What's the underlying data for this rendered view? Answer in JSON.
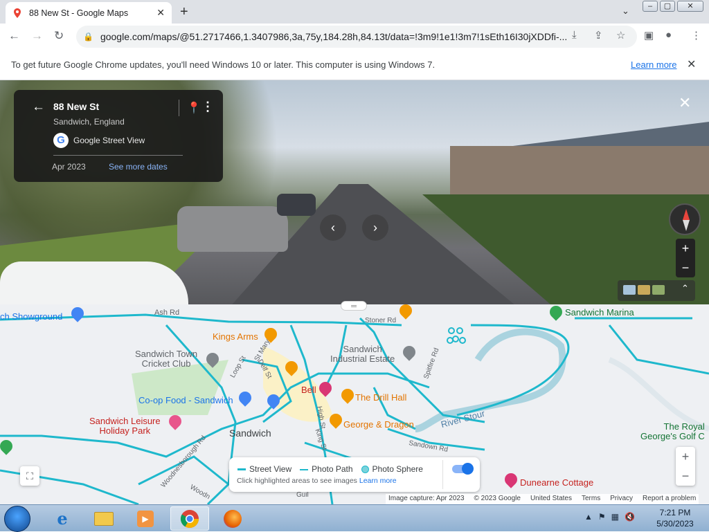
{
  "browser": {
    "tab_title": "88 New St - Google Maps",
    "tab_close": "✕",
    "new_tab": "+",
    "tab_menu": "⌄",
    "url": "google.com/maps/@51.2717466,1.3407986,3a,75y,184.28h,84.13t/data=!3m9!1e1!3m7!1sEth16I30jXDDfi-...",
    "window_controls": [
      "–",
      "▢",
      "✕"
    ]
  },
  "infobar": {
    "message": "To get future Google Chrome updates, you'll need Windows 10 or later. This computer is using Windows 7.",
    "link": "Learn more",
    "close": "✕"
  },
  "street_view": {
    "address": "88 New St",
    "location": "Sandwich, England",
    "provider": "Google Street View",
    "provider_logo": "G",
    "date": "Apr 2023",
    "see_more_dates": "See more dates",
    "close": "✕",
    "zoom_in": "+",
    "zoom_out": "−",
    "nav_prev": "‹",
    "nav_next": "›",
    "thumbs_toggle": "⌃"
  },
  "map": {
    "labels": {
      "showground": "ch Showground",
      "ash_rd": "Ash Rd",
      "kings_arms": "Kings Arms",
      "sandwich_town_cricket": "Sandwich Town\nCricket Club",
      "co_op": "Co-op Food - Sandwich",
      "sandwich_leisure": "Sandwich Leisure\nHoliday Park",
      "sandwich": "Sandwich",
      "industrial": "Sandwich\nIndustrial Estate",
      "stoner_rd": "Stoner Rd",
      "spitfire": "Spitfire Rd",
      "bell": "Bell",
      "drill_hall": "The Drill Hall",
      "george_dragon": "George & Dragon",
      "river_stour": "River Stour",
      "sandwich_marina": "Sandwich Marina",
      "royal_golf": "The Royal\nGeorge's Golf C",
      "dunearne": "Dunearne Cottage",
      "woodnesborough": "Woodnesborough Rd",
      "high_st": "High St",
      "king_st": "King St",
      "sandown_rd": "Sandown Rd",
      "loop_st": "Loop St",
      "delf_st": "Delf St",
      "st_marys": "St Mary's",
      "guil": "Guil",
      "woodn": "Woodn"
    },
    "legend": {
      "street_view": "Street View",
      "photo_path": "Photo Path",
      "photo_sphere": "Photo Sphere",
      "hint": "Click highlighted areas to see images",
      "learn_more": "Learn more"
    },
    "zoom_in": "+",
    "zoom_out": "−",
    "expand": "⛶",
    "attribution": [
      "Image capture: Apr 2023",
      "© 2023 Google",
      "United States",
      "Terms",
      "Privacy",
      "Report a problem"
    ]
  },
  "taskbar": {
    "time": "7:21 PM",
    "date": "5/30/2023"
  },
  "colors": {
    "street_view_line": "#1eb8cc",
    "accent": "#1a73e8",
    "orange_poi": "#e37400",
    "pink_poi": "#d93674"
  }
}
